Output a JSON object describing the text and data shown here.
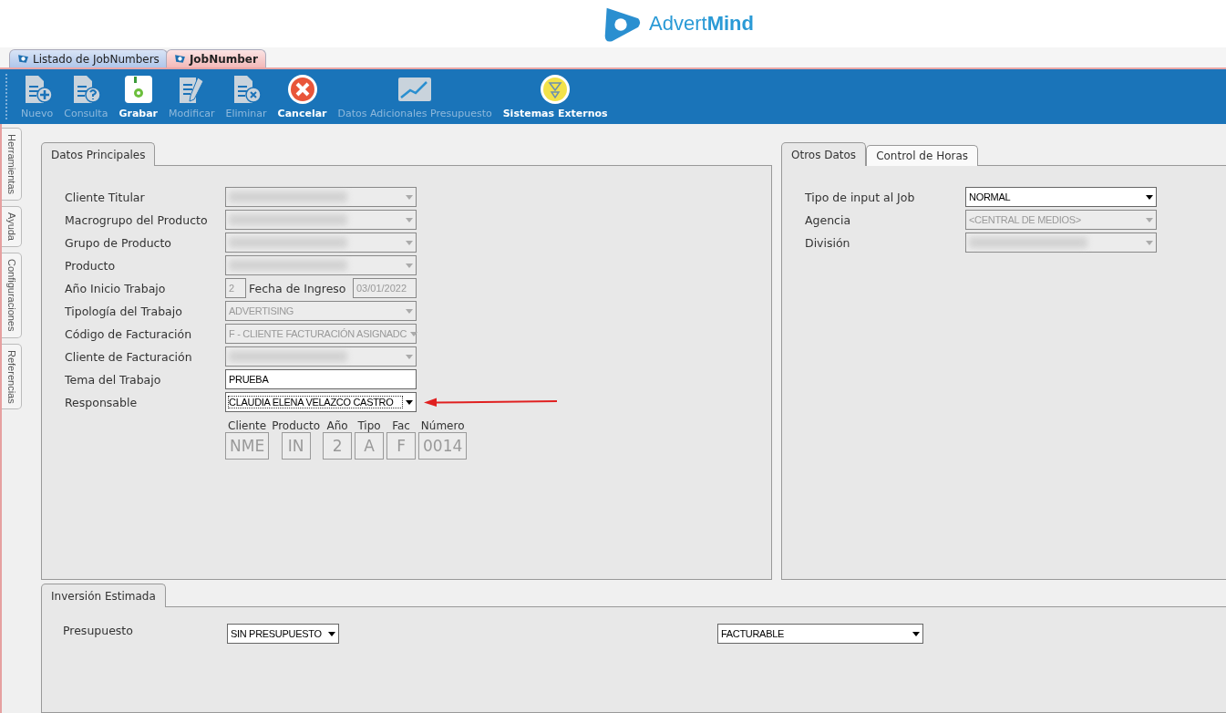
{
  "logo": {
    "text": "Advert**Mind**"
  },
  "doc_tabs": [
    {
      "label": "Listado de JobNumbers",
      "selected": false
    },
    {
      "label": "JobNumber",
      "selected": true
    }
  ],
  "toolbar": [
    {
      "label": "Nuevo",
      "kind": "new",
      "disabled": true
    },
    {
      "label": "Consulta",
      "kind": "query",
      "disabled": true
    },
    {
      "label": "Grabar",
      "kind": "save",
      "disabled": false
    },
    {
      "label": "Modificar",
      "kind": "edit",
      "disabled": true
    },
    {
      "label": "Eliminar",
      "kind": "delete",
      "disabled": true
    },
    {
      "label": "Cancelar",
      "kind": "cancel",
      "disabled": false
    },
    {
      "label": "Datos Adicionales Presupuesto",
      "kind": "chart",
      "disabled": true
    },
    {
      "label": "Sistemas Externos",
      "kind": "external",
      "disabled": false
    }
  ],
  "side_tabs": [
    {
      "label": "Herramientas"
    },
    {
      "label": "Ayuda"
    },
    {
      "label": "Configuraciones"
    },
    {
      "label": "Referencias"
    }
  ],
  "main_panel": {
    "tabs": [
      {
        "label": "Datos Principales",
        "selected": true
      }
    ],
    "fields": [
      {
        "label": "Cliente Titular",
        "kind": "select",
        "disabled": true,
        "redacted": true
      },
      {
        "label": "Macrogrupo del Producto",
        "kind": "select",
        "disabled": true,
        "redacted": true
      },
      {
        "label": "Grupo de Producto",
        "kind": "select",
        "disabled": true,
        "redacted": true
      },
      {
        "label": "Producto",
        "kind": "select",
        "disabled": true,
        "redacted": true
      },
      {
        "label": "Año Inicio Trabajo",
        "kind": "year_date",
        "value": "2",
        "date_label": "Fecha de Ingreso",
        "date": "03/01/2022",
        "disabled": true
      },
      {
        "label": "Tipología del Trabajo",
        "kind": "select",
        "value": "ADVERTISING",
        "disabled": true
      },
      {
        "label": "Código de Facturación",
        "kind": "select",
        "value": "F - CLIENTE FACTURACIÓN ASIGNADC",
        "disabled": true
      },
      {
        "label": "Cliente de Facturación",
        "kind": "select",
        "disabled": true,
        "redacted": true
      },
      {
        "label": "Tema del Trabajo",
        "kind": "text",
        "value": "PRUEBA",
        "disabled": false
      },
      {
        "label": "Responsable",
        "kind": "select",
        "value": "CLAUDIA ELENA VELAZCO CASTRO",
        "disabled": false,
        "focused": true,
        "marked": true
      }
    ],
    "code": [
      {
        "label": "Cliente",
        "value": "NME"
      },
      {
        "label": "Producto",
        "value": "IN"
      },
      {
        "label": "Año",
        "value": "2"
      },
      {
        "label": "Tipo",
        "value": "A"
      },
      {
        "label": "Fac",
        "value": "F"
      },
      {
        "label": "Número",
        "value": "0014"
      }
    ]
  },
  "other_panel": {
    "tabs": [
      {
        "label": "Otros Datos",
        "selected": true
      },
      {
        "label": "Control de Horas",
        "selected": false
      }
    ],
    "fields": [
      {
        "label": "Tipo de input al Job",
        "kind": "select",
        "value": "NORMAL",
        "disabled": false
      },
      {
        "label": "Agencia",
        "kind": "select",
        "value": "<CENTRAL DE MEDIOS>",
        "disabled": true
      },
      {
        "label": "División",
        "kind": "select",
        "disabled": true,
        "redacted": true
      }
    ]
  },
  "investment_panel": {
    "tabs": [
      {
        "label": "Inversión Estimada",
        "selected": true
      }
    ],
    "label": "Presupuesto",
    "budget": "SIN PRESUPUESTO",
    "billing": "FACTURABLE"
  }
}
